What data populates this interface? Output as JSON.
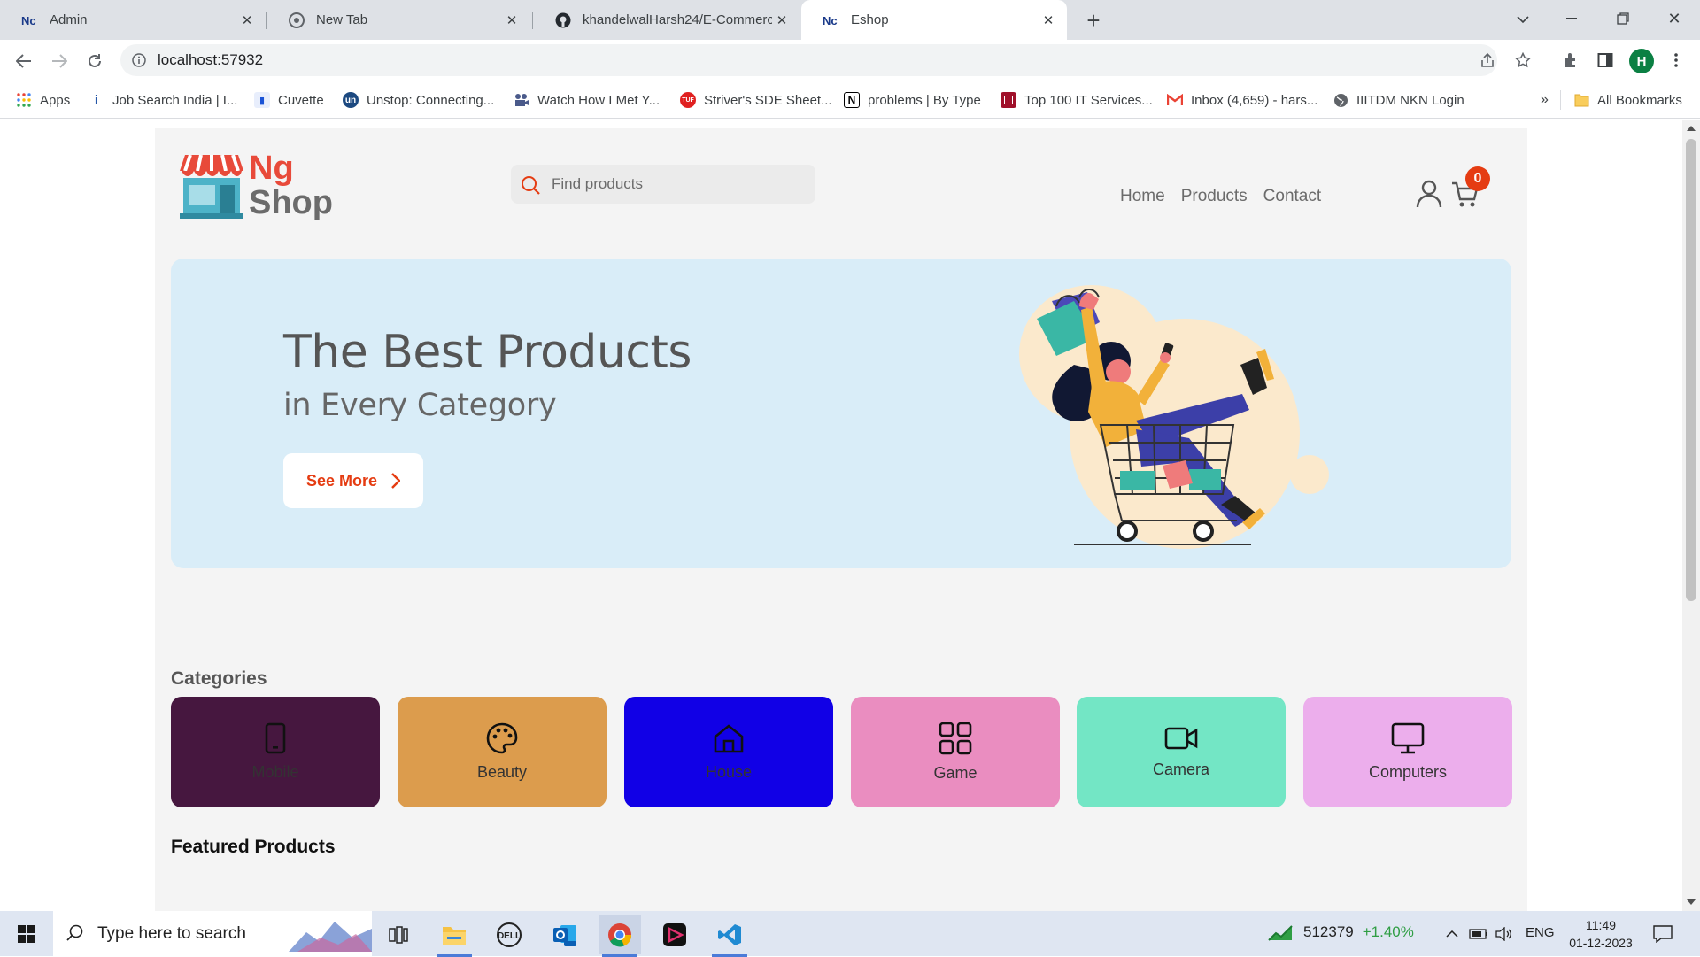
{
  "browser": {
    "tabs": [
      {
        "title": "Admin",
        "icon": "ng-logo-icon",
        "active": false
      },
      {
        "title": "New Tab",
        "icon": "chrome-icon",
        "active": false
      },
      {
        "title": "khandelwalHarsh24/E-Commerc",
        "icon": "github-icon",
        "active": false
      },
      {
        "title": "Eshop",
        "icon": "ng-logo-icon",
        "active": true
      }
    ],
    "url": "localhost:57932",
    "profile_initial": "H",
    "bookmarks": [
      {
        "label": "Apps",
        "icon": "apps-grid-icon"
      },
      {
        "label": "Job Search India | I...",
        "icon": "indeed-icon"
      },
      {
        "label": "Cuvette",
        "icon": "cuvette-icon"
      },
      {
        "label": "Unstop: Connecting...",
        "icon": "unstop-icon"
      },
      {
        "label": "Watch How I Met Y...",
        "icon": "video-icon"
      },
      {
        "label": "Striver's SDE Sheet...",
        "icon": "tuf-icon"
      },
      {
        "label": "problems | By Type",
        "icon": "notion-icon"
      },
      {
        "label": "Top 100 IT Services...",
        "icon": "bookmark-red-icon"
      },
      {
        "label": "Inbox (4,659) - hars...",
        "icon": "gmail-icon"
      },
      {
        "label": "IIITDM NKN Login",
        "icon": "globe-icon"
      }
    ],
    "bookmarks_overflow": "»",
    "all_bookmarks": "All Bookmarks"
  },
  "shop": {
    "logo_line1": "Ng",
    "logo_line2": "Shop",
    "search_placeholder": "Find products",
    "nav": [
      "Home",
      "Products",
      "Contact"
    ],
    "cart_count": "0",
    "hero": {
      "title": "The Best Products",
      "subtitle": "in Every Category",
      "button": "See More"
    },
    "categories_heading": "Categories",
    "categories": [
      {
        "label": "Mobile",
        "color": "#46173f",
        "icon": "mobile-icon"
      },
      {
        "label": "Beauty",
        "color": "#dc9c4d",
        "icon": "palette-icon"
      },
      {
        "label": "House",
        "color": "#1100e6",
        "icon": "house-icon"
      },
      {
        "label": "Game",
        "color": "#ea8dc0",
        "icon": "grid-icon"
      },
      {
        "label": "Camera",
        "color": "#73e6c5",
        "icon": "video-camera-icon"
      },
      {
        "label": "Computers",
        "color": "#ecaeec",
        "icon": "monitor-icon"
      }
    ],
    "featured_heading": "Featured Products"
  },
  "taskbar": {
    "search_placeholder": "Type here to search",
    "stock_value": "512379",
    "stock_change": "+1.40%",
    "language": "ENG",
    "time": "11:49",
    "date": "01-12-2023"
  },
  "colors": {
    "accent_red": "#e53c12",
    "hero_bg": "#d9edf8"
  }
}
